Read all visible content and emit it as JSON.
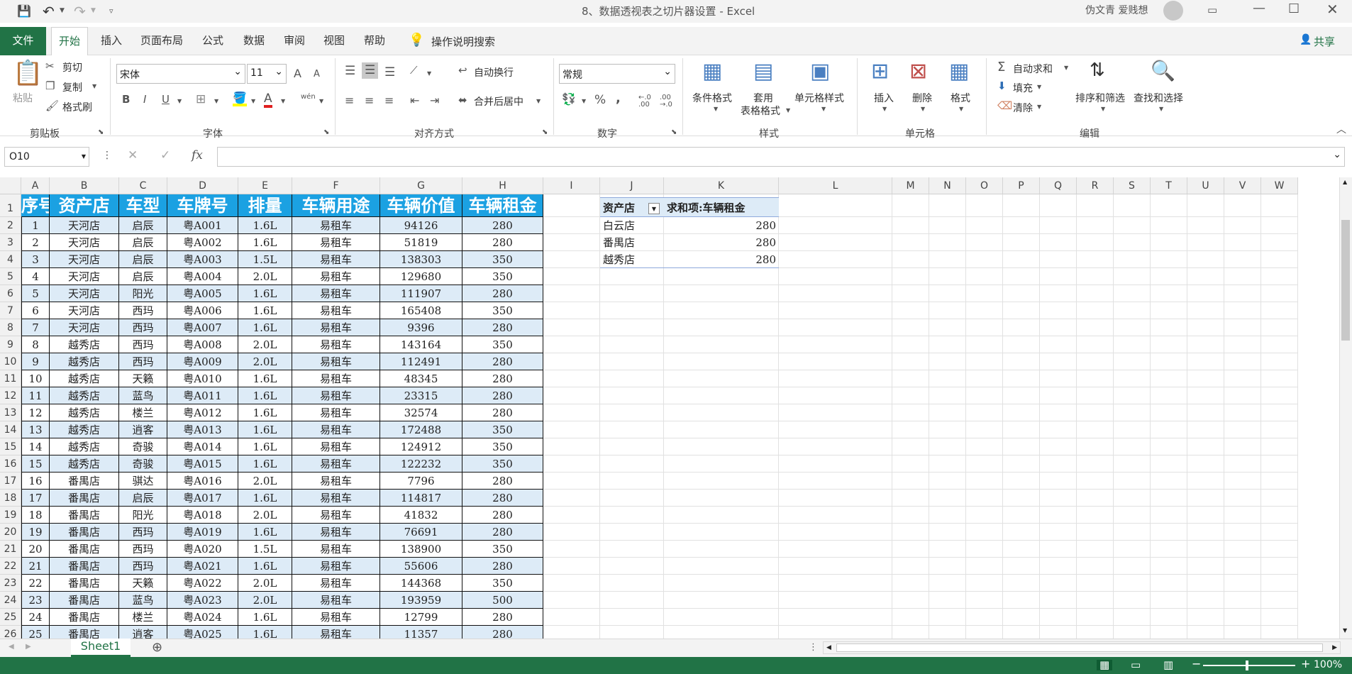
{
  "title": {
    "text": "8、数据透视表之切片器设置  -  Excel",
    "user": "伪文青 爱贱想"
  },
  "tabs": [
    "文件",
    "开始",
    "插入",
    "页面布局",
    "公式",
    "数据",
    "审阅",
    "视图",
    "帮助"
  ],
  "active_tab_index": 1,
  "tell_me": "操作说明搜索",
  "share": "共享",
  "ribbon": {
    "clipboard": {
      "paste": "粘贴",
      "cut": "剪切",
      "copy": "复制",
      "format_painter": "格式刷",
      "group": "剪贴板"
    },
    "font": {
      "name": "宋体",
      "size": "11",
      "group": "字体",
      "bold": "B",
      "italic": "I",
      "underline": "U",
      "grow": "A",
      "shrink": "A",
      "phonetic": "wén"
    },
    "alignment": {
      "wrap": "自动换行",
      "merge": "合并后居中",
      "group": "对齐方式"
    },
    "number": {
      "format": "常规",
      "group": "数字",
      "percent": "%",
      "comma": ","
    },
    "styles": {
      "conditional": "条件格式",
      "table1": "套用",
      "table2": "表格格式",
      "cell_styles": "单元格样式",
      "group": "样式"
    },
    "cells": {
      "insert": "插入",
      "delete": "删除",
      "format": "格式",
      "group": "单元格"
    },
    "editing": {
      "autosum": "自动求和",
      "fill": "填充",
      "clear": "清除",
      "sort": "排序和筛选",
      "find": "查找和选择",
      "group": "编辑"
    }
  },
  "formula_bar": {
    "name_box": "O10",
    "fx": "fx",
    "formula": ""
  },
  "columns": [
    "A",
    "B",
    "C",
    "D",
    "E",
    "F",
    "G",
    "H",
    "I",
    "J",
    "K",
    "L",
    "M",
    "N",
    "O",
    "P",
    "Q",
    "R",
    "S",
    "T",
    "U",
    "V",
    "W"
  ],
  "table": {
    "headers": [
      "序号",
      "资产店",
      "车型",
      "车牌号",
      "排量",
      "车辆用途",
      "车辆价值",
      "车辆租金"
    ],
    "rows": [
      [
        "1",
        "天河店",
        "启辰",
        "粤A001",
        "1.6L",
        "易租车",
        "94126",
        "280"
      ],
      [
        "2",
        "天河店",
        "启辰",
        "粤A002",
        "1.6L",
        "易租车",
        "51819",
        "280"
      ],
      [
        "3",
        "天河店",
        "启辰",
        "粤A003",
        "1.5L",
        "易租车",
        "138303",
        "350"
      ],
      [
        "4",
        "天河店",
        "启辰",
        "粤A004",
        "2.0L",
        "易租车",
        "129680",
        "350"
      ],
      [
        "5",
        "天河店",
        "阳光",
        "粤A005",
        "1.6L",
        "易租车",
        "111907",
        "280"
      ],
      [
        "6",
        "天河店",
        "西玛",
        "粤A006",
        "1.6L",
        "易租车",
        "165408",
        "350"
      ],
      [
        "7",
        "天河店",
        "西玛",
        "粤A007",
        "1.6L",
        "易租车",
        "9396",
        "280"
      ],
      [
        "8",
        "越秀店",
        "西玛",
        "粤A008",
        "2.0L",
        "易租车",
        "143164",
        "350"
      ],
      [
        "9",
        "越秀店",
        "西玛",
        "粤A009",
        "2.0L",
        "易租车",
        "112491",
        "280"
      ],
      [
        "10",
        "越秀店",
        "天籁",
        "粤A010",
        "1.6L",
        "易租车",
        "48345",
        "280"
      ],
      [
        "11",
        "越秀店",
        "蓝鸟",
        "粤A011",
        "1.6L",
        "易租车",
        "23315",
        "280"
      ],
      [
        "12",
        "越秀店",
        "楼兰",
        "粤A012",
        "1.6L",
        "易租车",
        "32574",
        "280"
      ],
      [
        "13",
        "越秀店",
        "逍客",
        "粤A013",
        "1.6L",
        "易租车",
        "172488",
        "350"
      ],
      [
        "14",
        "越秀店",
        "奇骏",
        "粤A014",
        "1.6L",
        "易租车",
        "124912",
        "350"
      ],
      [
        "15",
        "越秀店",
        "奇骏",
        "粤A015",
        "1.6L",
        "易租车",
        "122232",
        "350"
      ],
      [
        "16",
        "番禺店",
        "骐达",
        "粤A016",
        "2.0L",
        "易租车",
        "7796",
        "280"
      ],
      [
        "17",
        "番禺店",
        "启辰",
        "粤A017",
        "1.6L",
        "易租车",
        "114817",
        "280"
      ],
      [
        "18",
        "番禺店",
        "阳光",
        "粤A018",
        "2.0L",
        "易租车",
        "41832",
        "280"
      ],
      [
        "19",
        "番禺店",
        "西玛",
        "粤A019",
        "1.6L",
        "易租车",
        "76691",
        "280"
      ],
      [
        "20",
        "番禺店",
        "西玛",
        "粤A020",
        "1.5L",
        "易租车",
        "138900",
        "350"
      ],
      [
        "21",
        "番禺店",
        "西玛",
        "粤A021",
        "1.6L",
        "易租车",
        "55606",
        "280"
      ],
      [
        "22",
        "番禺店",
        "天籁",
        "粤A022",
        "2.0L",
        "易租车",
        "144368",
        "350"
      ],
      [
        "23",
        "番禺店",
        "蓝鸟",
        "粤A023",
        "2.0L",
        "易租车",
        "193959",
        "500"
      ],
      [
        "24",
        "番禺店",
        "楼兰",
        "粤A024",
        "1.6L",
        "易租车",
        "12799",
        "280"
      ],
      [
        "25",
        "番禺店",
        "逍客",
        "粤A025",
        "1.6L",
        "易租车",
        "11357",
        "280"
      ]
    ]
  },
  "pivot": {
    "row_header": "资产店",
    "value_header": "求和项:车辆租金",
    "rows": [
      [
        "白云店",
        "280"
      ],
      [
        "番禺店",
        "280"
      ],
      [
        "越秀店",
        "280"
      ]
    ]
  },
  "sheet_tab": "Sheet1",
  "zoom": "100%"
}
